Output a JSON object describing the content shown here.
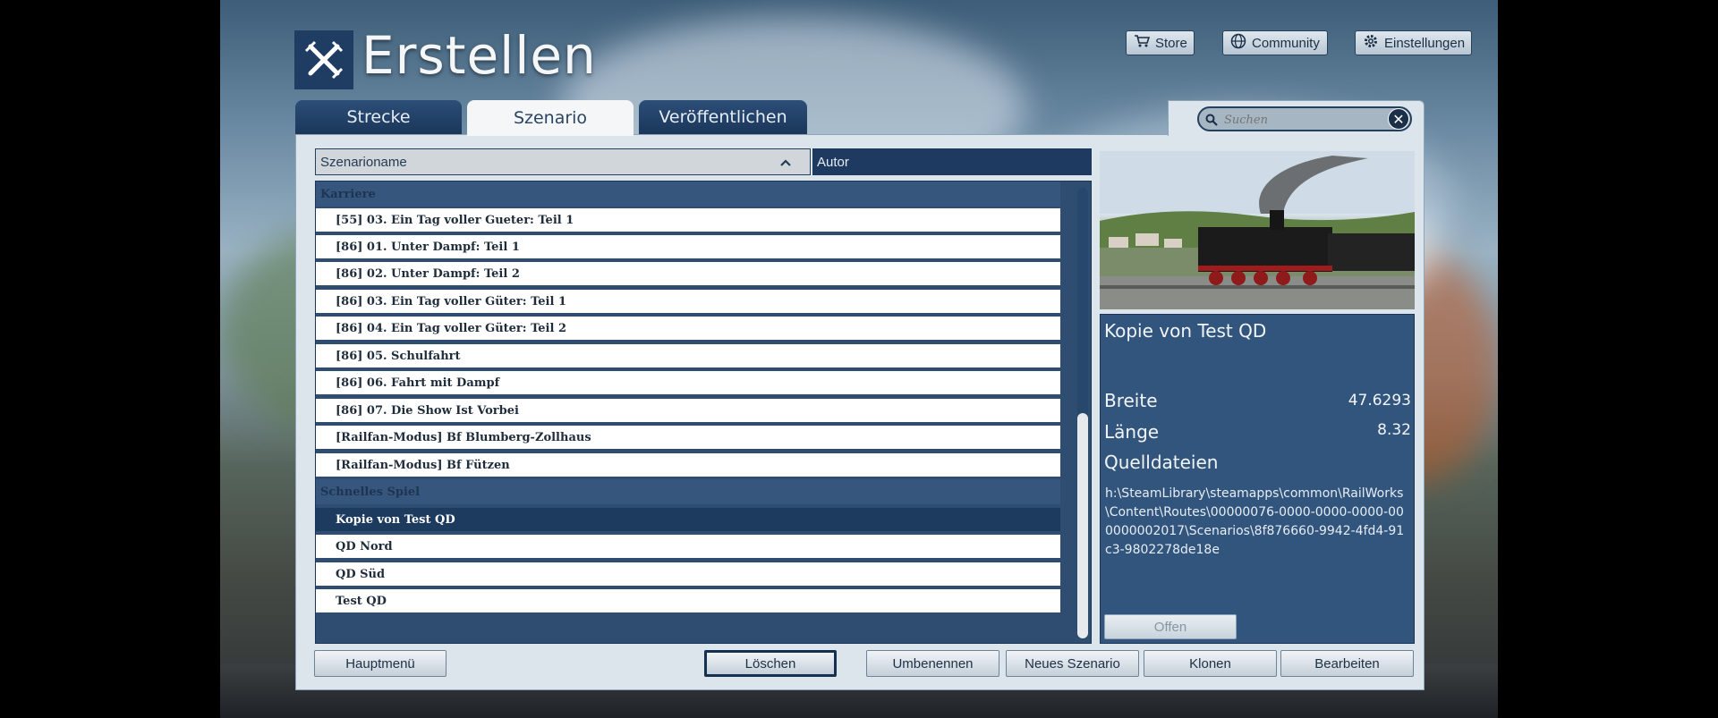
{
  "app": {
    "title": "Erstellen"
  },
  "top_buttons": {
    "store": "Store",
    "community": "Community",
    "settings": "Einstellungen"
  },
  "tabs": [
    {
      "label": "Strecke",
      "active": false
    },
    {
      "label": "Szenario",
      "active": true
    },
    {
      "label": "Veröffentlichen",
      "active": false
    }
  ],
  "search": {
    "placeholder": "Suchen",
    "value": ""
  },
  "columns": {
    "name": "Szenarioname",
    "author": "Autor",
    "sort": "ascending"
  },
  "groups": [
    {
      "label": "Karriere",
      "items": [
        "[55] 03. Ein Tag voller Gueter: Teil 1",
        "[86] 01. Unter Dampf: Teil 1",
        "[86] 02. Unter Dampf: Teil 2",
        "[86] 03. Ein Tag voller Güter: Teil 1",
        "[86] 04. Ein Tag voller Güter: Teil 2",
        "[86] 05. Schulfahrt",
        "[86] 06. Fahrt mit Dampf",
        "[86] 07. Die Show Ist Vorbei",
        "[Railfan-Modus] Bf Blumberg-Zollhaus",
        "[Railfan-Modus] Bf Fützen"
      ]
    },
    {
      "label": "Schnelles Spiel",
      "items": [
        "Kopie von Test QD",
        "QD Nord",
        "QD Süd",
        "Test QD"
      ]
    }
  ],
  "selected": "Kopie von Test QD",
  "details": {
    "title": "Kopie von Test QD",
    "width_label": "Breite",
    "width_value": "47.6293",
    "length_label": "Länge",
    "length_value": "8.32",
    "sources_label": "Quelldateien",
    "path": "h:\\SteamLibrary\\steamapps\\common\\RailWorks\\Content\\Routes\\00000076-0000-0000-0000-000000002017\\Scenarios\\8f876660-9942-4fd4-91c3-9802278de18e",
    "open_button": "Offen"
  },
  "bottom_buttons": {
    "main_menu": "Hauptmenü",
    "delete": "Löschen",
    "rename": "Umbenennen",
    "new_scenario": "Neues Szenario",
    "clone": "Klonen",
    "edit": "Bearbeiten"
  },
  "colors": {
    "panel_dark": "#1e3a60",
    "panel_light": "#dde5ec",
    "selection": "#1d3a5f"
  }
}
